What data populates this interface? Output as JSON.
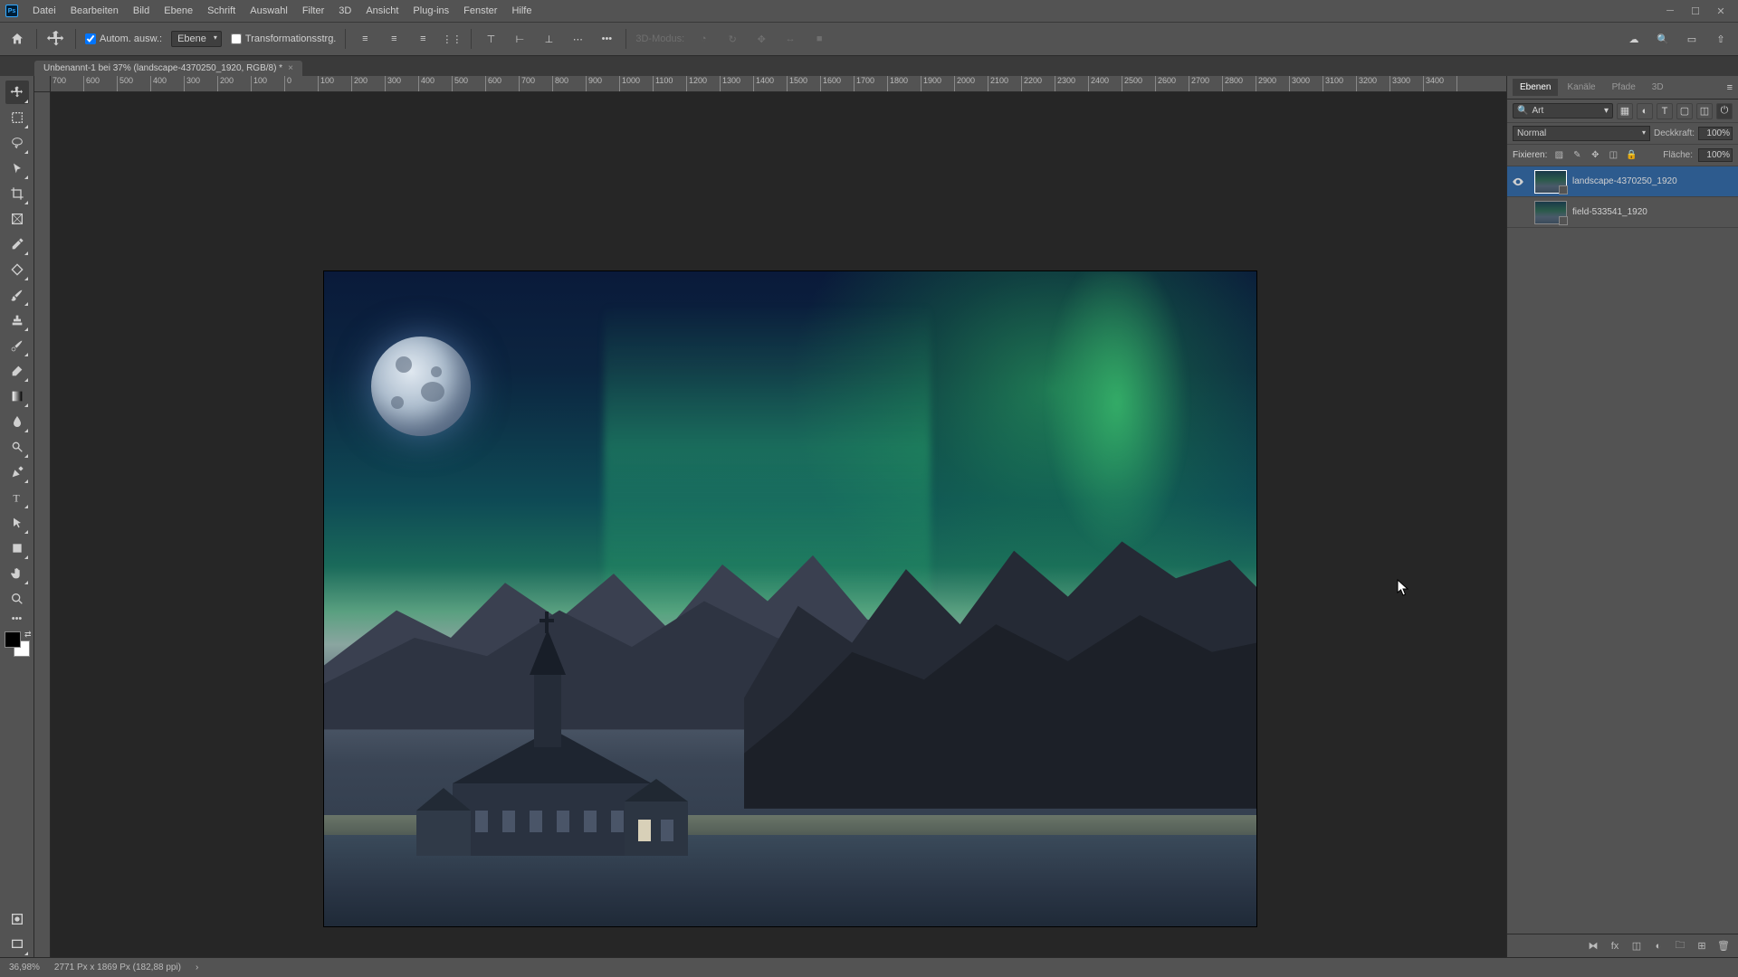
{
  "menu": {
    "items": [
      "Datei",
      "Bearbeiten",
      "Bild",
      "Ebene",
      "Schrift",
      "Auswahl",
      "Filter",
      "3D",
      "Ansicht",
      "Plug-ins",
      "Fenster",
      "Hilfe"
    ]
  },
  "optbar": {
    "auto_select": "Autom. ausw.:",
    "target": "Ebene",
    "transform": "Transformationsstrg.",
    "mode3d": "3D-Modus:"
  },
  "doc_tab": {
    "title": "Unbenannt-1 bei 37% (landscape-4370250_1920, RGB/8) *"
  },
  "ruler_h": [
    "700",
    "600",
    "500",
    "400",
    "300",
    "200",
    "100",
    "0",
    "100",
    "200",
    "300",
    "400",
    "500",
    "600",
    "700",
    "800",
    "900",
    "1000",
    "1100",
    "1200",
    "1300",
    "1400",
    "1500",
    "1600",
    "1700",
    "1800",
    "1900",
    "2000",
    "2100",
    "2200",
    "2300",
    "2400",
    "2500",
    "2600",
    "2700",
    "2800",
    "2900",
    "3000",
    "3100",
    "3200",
    "3300",
    "3400"
  ],
  "panels": {
    "tabs": [
      "Ebenen",
      "Kanäle",
      "Pfade",
      "3D"
    ],
    "search_label": "Art",
    "blend_mode": "Normal",
    "opacity_label": "Deckkraft:",
    "opacity_val": "100%",
    "lock_label": "Fixieren:",
    "fill_label": "Fläche:",
    "fill_val": "100%",
    "layers": [
      {
        "visible": true,
        "name": "landscape-4370250_1920",
        "selected": true
      },
      {
        "visible": false,
        "name": "field-533541_1920",
        "selected": false
      }
    ]
  },
  "status": {
    "zoom": "36,98%",
    "dims": "2771 Px x 1869 Px (182,88 ppi)"
  }
}
